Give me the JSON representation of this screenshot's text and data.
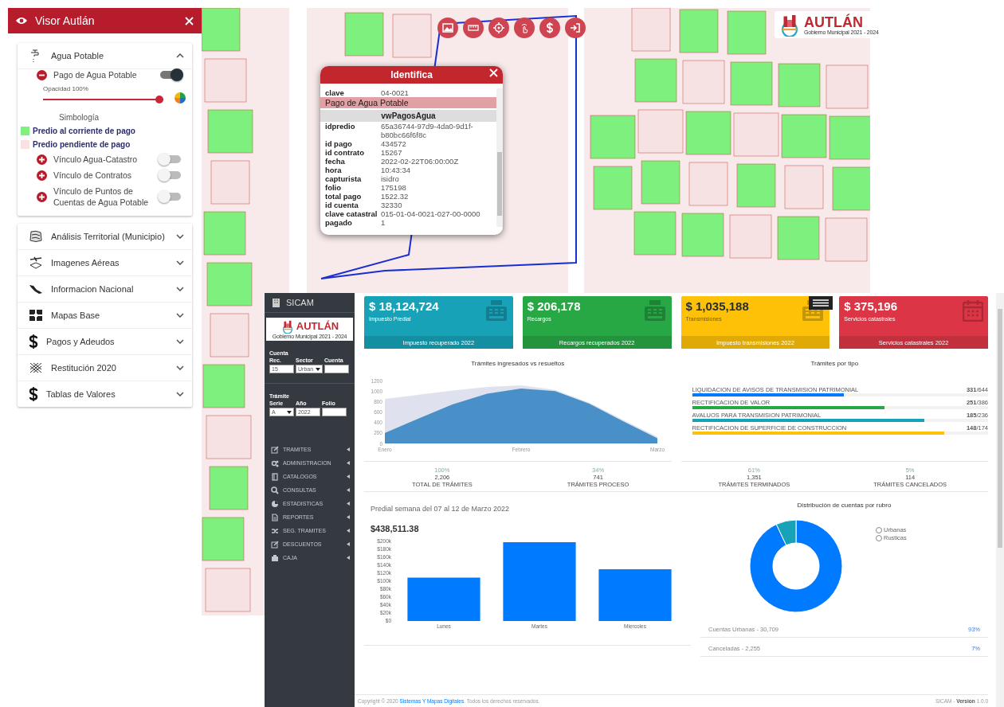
{
  "viewer": {
    "title": "Visor Autlán",
    "groups": [
      {
        "kind": "water",
        "title": "Agua Potable",
        "expanded": true,
        "layers": [
          {
            "label": "Pago de Agua Potable",
            "expanded": true,
            "on": true,
            "opacity": {
              "label": "Opacidad 100%",
              "level": 1
            },
            "legend_title": "Simbología",
            "legend": [
              {
                "label": "Predio al corriente de pago",
                "color": "#80f080"
              },
              {
                "label": "Predio pendiente de pago",
                "color": "#f7e1e1"
              }
            ]
          },
          {
            "label": "Vínculo Agua-Catastro",
            "expanded": false,
            "on": false
          },
          {
            "label": "Vínculo de Contratos",
            "expanded": false,
            "on": false
          },
          {
            "label": "Vínculo de Puntos de Cuentas de Agua Potable",
            "expanded": false,
            "on": false
          }
        ]
      },
      {
        "kind": "territory",
        "title": "Análisis Territorial (Municipio)",
        "expanded": false
      },
      {
        "kind": "aerial",
        "title": "Imagenes Aéreas",
        "expanded": false
      },
      {
        "kind": "country",
        "title": "Informacion Nacional",
        "expanded": false
      },
      {
        "kind": "basemap",
        "title": "Mapas Base",
        "expanded": false
      },
      {
        "kind": "money",
        "title": "Pagos y Adeudos",
        "expanded": false
      },
      {
        "kind": "mesh",
        "title": "Restitución 2020",
        "expanded": false
      },
      {
        "kind": "money",
        "title": "Tablas de Valores",
        "expanded": false
      }
    ]
  },
  "map_toolbar": [
    {
      "kind": "image"
    },
    {
      "kind": "ruler"
    },
    {
      "kind": "locate"
    },
    {
      "kind": "tap"
    },
    {
      "kind": "money"
    },
    {
      "kind": "login"
    }
  ],
  "map_logo": {
    "name": "AUTLÁN",
    "subtitle": "Gobierno Municipal 2021 - 2024"
  },
  "popup": {
    "title": "Identifica",
    "rows": [
      {
        "kind": "field",
        "label": "clave",
        "value": "04-0021"
      },
      {
        "kind": "section",
        "label": "Pago de Agua Potable"
      },
      {
        "kind": "subheader",
        "label": "vwPagosAgua"
      },
      {
        "kind": "field",
        "label": "idpredio",
        "value": "65a36744-97d9-4da0-9d1f-b80bc66f6f8c"
      },
      {
        "kind": "field",
        "label": "id pago",
        "value": "434572"
      },
      {
        "kind": "field",
        "label": "id contrato",
        "value": "15267"
      },
      {
        "kind": "field",
        "label": "fecha",
        "value": "2022-02-22T06:00:00Z"
      },
      {
        "kind": "field",
        "label": "hora",
        "value": "10:43:34"
      },
      {
        "kind": "field",
        "label": "capturista",
        "value": "isidro"
      },
      {
        "kind": "field",
        "label": "folio",
        "value": "175198"
      },
      {
        "kind": "field",
        "label": "total pago",
        "value": "1522.32"
      },
      {
        "kind": "field",
        "label": "id cuenta",
        "value": "32330"
      },
      {
        "kind": "field",
        "label": "clave catastral",
        "value": "015-01-04-0021-027-00-0000"
      },
      {
        "kind": "field",
        "label": "pagado",
        "value": "1"
      }
    ]
  },
  "dashboard": {
    "brand": "SICAM",
    "logo": {
      "name": "AUTLÁN",
      "subtitle": "Gobierno Municipal 2021 - 2024"
    },
    "forms": [
      {
        "title": "Cuenta",
        "fields": [
          {
            "label": "Rec.",
            "kind": "input",
            "value": "15"
          },
          {
            "label": "Sector",
            "kind": "select",
            "value": "Urban"
          },
          {
            "label": "Cuenta",
            "kind": "input"
          }
        ]
      },
      {
        "title": "Trámite",
        "fields": [
          {
            "label": "Serie",
            "kind": "select",
            "value": "A"
          },
          {
            "label": "Año",
            "kind": "input",
            "value": "2022"
          },
          {
            "label": "Folio",
            "kind": "input"
          }
        ]
      }
    ],
    "menu": [
      {
        "kind": "edit",
        "label": "TRAMITES"
      },
      {
        "kind": "gears",
        "label": "ADMINISTRACION"
      },
      {
        "kind": "book",
        "label": "CATALOGOS"
      },
      {
        "kind": "search",
        "label": "CONSULTAS"
      },
      {
        "kind": "pie",
        "label": "ESTADISTICAS"
      },
      {
        "kind": "file",
        "label": "REPORTES"
      },
      {
        "kind": "shuffle",
        "label": "SEG. TRAMITES"
      },
      {
        "kind": "edit",
        "label": "DESCUENTOS"
      },
      {
        "kind": "building",
        "label": "CAJA"
      }
    ],
    "cards": [
      {
        "kind": "register",
        "value": "$ 18,124,724",
        "label": "Impuesto Predial",
        "footer": "Impuesto recuperado 2022",
        "color": "#17a2b8"
      },
      {
        "kind": "register",
        "value": "$ 206,178",
        "label": "Recargos",
        "footer": "Recargos recuperados 2022",
        "color": "#28a745"
      },
      {
        "kind": "register",
        "value": "$ 1,035,188",
        "label": "Transmisiones",
        "footer": "Impuesto transmisiones 2022",
        "color": "#ffc107"
      },
      {
        "kind": "calendar",
        "value": "$ 375,196",
        "label": "Servicios catastrales",
        "footer": "Servicios catastrales 2022",
        "color": "#dc3545"
      }
    ],
    "ingresados": {
      "title": "Trámites ingresados vs resueltos",
      "chart_data": {
        "type": "area",
        "categories": [
          "Enero",
          null,
          null,
          null,
          "Febrero",
          null,
          null,
          null,
          "Marzo"
        ],
        "ylim": [
          0,
          1200
        ],
        "yticks": [
          0,
          200,
          400,
          600,
          800,
          1000,
          1200
        ],
        "series": [
          {
            "color": "#dfe2ee",
            "values": [
              850,
              930,
              1010,
              1080,
              1110,
              1020,
              780,
              450,
              130
            ]
          },
          {
            "color": "#4a90c8",
            "values": [
              200,
              480,
              750,
              950,
              1050,
              1000,
              760,
              420,
              100
            ]
          }
        ]
      }
    },
    "por_tipo": {
      "title": "Trámites por tipo",
      "items": [
        {
          "label": "LIQUIDACION DE AVISOS DE TRANSMISION PATRIMONIAL",
          "count": "**331**/644",
          "level": 0.514,
          "color": "#007bff"
        },
        {
          "label": "RECTIFICACION DE VALOR",
          "count": "**251**/386",
          "level": 0.65,
          "color": "#28a745"
        },
        {
          "label": "AVALUOS PARA TRANSMISION PATRIMONIAL",
          "count": "**185**/236",
          "level": 0.784,
          "color": "#17a2b8"
        },
        {
          "label": "RECTIFICACION DE SUPERFICIE DE CONSTRUCCION",
          "count": "**148**/174",
          "level": 0.851,
          "color": "#ffc107"
        }
      ]
    },
    "stats": [
      {
        "percent": "100%",
        "value": "2,206",
        "label": "TOTAL DE TRÁMITES"
      },
      {
        "percent": "34%",
        "value": "741",
        "label": "TRÁMITES PROCESO"
      },
      {
        "percent": "61%",
        "value": "1,351",
        "label": "TRÁMITES TERMINADOS"
      },
      {
        "percent": "5%",
        "value": "114",
        "label": "TRÁMITES CANCELADOS"
      }
    ],
    "predial": {
      "title": "Predial semana del 07 al 12 de Marzo 2022",
      "total": "$438,511.38",
      "chart_data": {
        "type": "bar",
        "categories": [
          "Lunes",
          "Martes",
          "Miercoles"
        ],
        "ylim": [
          0,
          200000
        ],
        "yticks": [
          {
            "value": 0,
            "label": "$0"
          },
          {
            "value": 20000,
            "label": "$20k"
          },
          {
            "value": 40000,
            "label": "$40k"
          },
          {
            "value": 60000,
            "label": "$60k"
          },
          {
            "value": 80000,
            "label": "$80k"
          },
          {
            "value": 100000,
            "label": "$100k"
          },
          {
            "value": 120000,
            "label": "$120k"
          },
          {
            "value": 140000,
            "label": "$140k"
          },
          {
            "value": 160000,
            "label": "$160k"
          },
          {
            "value": 180000,
            "label": "$180k"
          },
          {
            "value": 200000,
            "label": "$200k"
          }
        ],
        "series": [
          {
            "color": "#007bff",
            "values": [
              109000,
              198000,
              130000
            ]
          }
        ]
      }
    },
    "distribucion": {
      "title": "Distribución de cuentas por rubro",
      "chart_data": {
        "type": "donut",
        "categories": [
          "Urbanas",
          "Rusticas"
        ],
        "values": [
          93,
          7
        ],
        "colors": [
          "#007bff",
          "#17a2b8"
        ]
      },
      "rows": [
        {
          "label": "Cuentas Urbanas - 30,709",
          "percent": "93%"
        },
        {
          "label": "Canceladas - 2,255",
          "percent": "7%"
        }
      ]
    },
    "footer": {
      "prefix": "Copyright © 2020",
      "link": "Sistemas Y Mapas Digitales",
      "suffix": ". Todos los derechos reservados.",
      "version": "SICAM - **Version** 1.0.0"
    }
  }
}
